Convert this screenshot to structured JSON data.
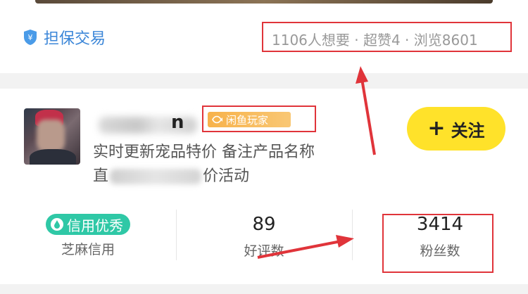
{
  "guarantee": {
    "label": "担保交易",
    "icon": "shield-icon",
    "color": "#3b86d8"
  },
  "stats_line": "1106人想要 · 超赞4 · 浏览8601",
  "user": {
    "username_visible_tail": "n",
    "badge": {
      "label": "闲鱼玩家",
      "icon": "fish-icon"
    },
    "bio_line1": "实时更新宠品特价 备注产品名称",
    "bio_line2_start": "直",
    "bio_line2_end": "价活动"
  },
  "follow_button": {
    "label": "关注",
    "icon": "plus-icon"
  },
  "profile_stats": [
    {
      "value": "信用优秀",
      "label": "芝麻信用",
      "icon": "drop-icon"
    },
    {
      "value": "89",
      "label": "好评数"
    },
    {
      "value": "3414",
      "label": "粉丝数"
    }
  ],
  "colors": {
    "highlight_box": "#e0343a",
    "follow_bg": "#ffe22a",
    "credit_bg": "#2fc8a6",
    "badge_bg": "#f7b24b"
  }
}
